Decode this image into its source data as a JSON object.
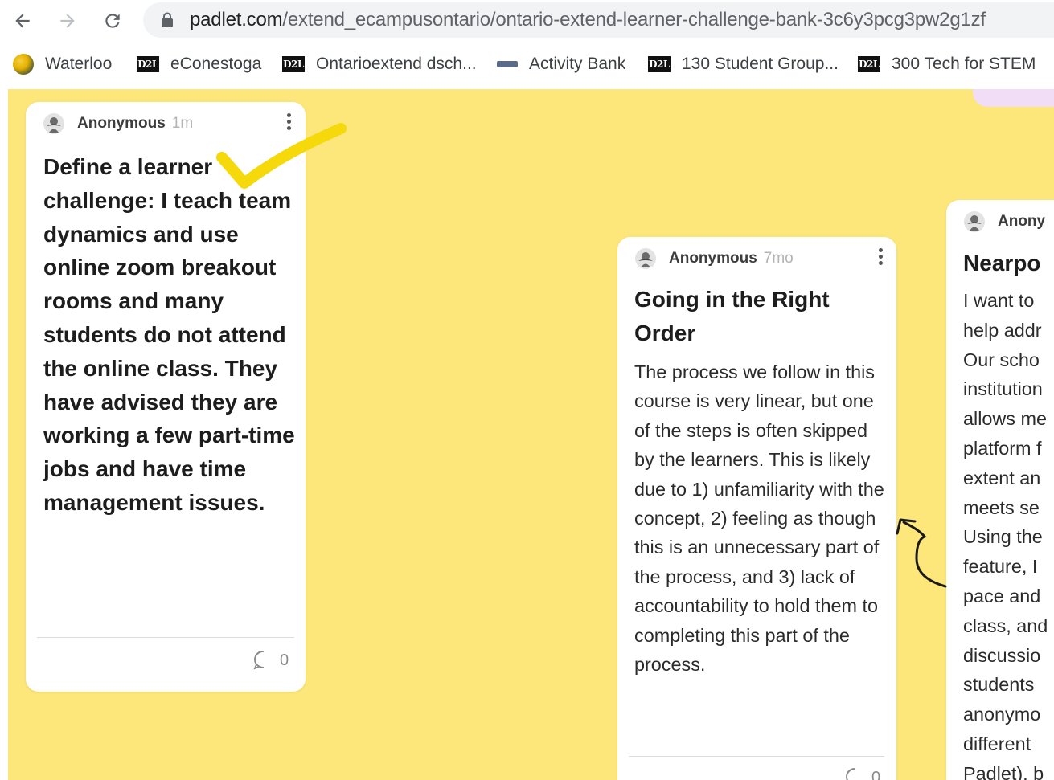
{
  "browser": {
    "url_host": "padlet.com",
    "url_path": "/extend_ecampusontario/ontario-extend-learner-challenge-bank-3c6y3pcg3pw2g1zf",
    "bookmarks": [
      {
        "label": "Waterloo",
        "icon": "waterloo-favicon"
      },
      {
        "label": "eConestoga",
        "icon": "d2l-favicon"
      },
      {
        "label": "Ontarioextend dsch...",
        "icon": "d2l-favicon"
      },
      {
        "label": "Activity Bank",
        "icon": "activity-bank-favicon"
      },
      {
        "label": "130 Student Group...",
        "icon": "d2l-favicon"
      },
      {
        "label": "300 Tech for STEM",
        "icon": "d2l-favicon"
      }
    ],
    "d2l_text": "D2L"
  },
  "board": {
    "background_color": "#fde67a",
    "cards": [
      {
        "author": "Anonymous",
        "time": "1m",
        "title": "Define a learner challenge: I teach team dynamics and use online zoom breakout rooms and many students do not attend the online class. They have advised they are working a few part-time jobs and have time management issues.",
        "comment_count": "0"
      },
      {
        "author": "Anonymous",
        "time": "7mo",
        "title": "Going in the Right Order",
        "body": "The process we follow in this course is very linear, but one of the steps is often skipped by the learners. This is likely due to 1) unfamiliarity with the concept, 2) feeling as though this is an unnecessary part of the process, and 3) lack of accountability to hold them to completing this part of the process.",
        "comment_count": "0"
      },
      {
        "author": "Anony",
        "title": "Nearpo",
        "body_lines": [
          "I want to",
          "help addr",
          "Our scho",
          "institution",
          "allows me",
          "platform f",
          "extent an",
          "meets se",
          "Using the",
          "feature, I",
          "pace and",
          "class, and",
          "discussio",
          "students",
          "anonymo",
          "different",
          "Padlet), b"
        ]
      }
    ]
  },
  "annotations": {
    "checkmark_color": "#f5d90a",
    "arrow_color": "#1a1a1a"
  }
}
